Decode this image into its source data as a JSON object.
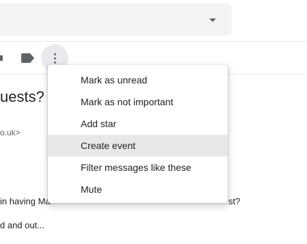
{
  "toolbar": {
    "icons": [
      "move-to-icon",
      "label-icon",
      "more-options-icon"
    ]
  },
  "email": {
    "subject_fragment": "uests?",
    "sender_email_fragment": "o.uk>",
    "body_line_1_start": "in having Ma",
    "body_line_1_end": "st?",
    "body_line_2": "d and out..."
  },
  "menu": {
    "items": [
      {
        "label": "Mark as unread"
      },
      {
        "label": "Mark as not important"
      },
      {
        "label": "Add star"
      },
      {
        "label": "Create event"
      },
      {
        "label": "Filter messages like these"
      },
      {
        "label": "Mute"
      }
    ],
    "hovered_item": "Create event"
  },
  "colors": {
    "search_bg": "#f1f3f4",
    "hover_bg": "#e8e8e8",
    "icon": "#5f6368"
  }
}
